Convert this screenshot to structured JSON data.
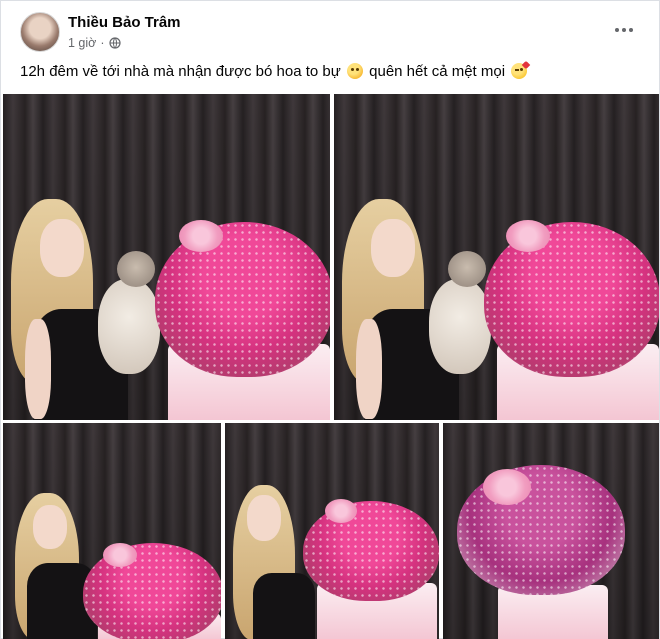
{
  "post": {
    "author": "Thiều Bảo Trâm",
    "time": "1 giờ",
    "privacy_icon": "globe-icon",
    "menu_icon": "more-dots-icon",
    "caption": {
      "part1": "12h đêm về tới nhà mà nhận được bó hoa to bự",
      "emoji1": "pleading-face-emoji",
      "part2": "quên hết cả mệt mọi",
      "emoji2": "kissing-face-emoji"
    }
  },
  "photos": [
    {
      "name": "photo-1",
      "subject": "girl-with-cat-and-bouquet"
    },
    {
      "name": "photo-2",
      "subject": "girl-with-cat-and-bouquet"
    },
    {
      "name": "photo-3",
      "subject": "girl-with-bouquet"
    },
    {
      "name": "photo-4",
      "subject": "girl-with-bouquet"
    },
    {
      "name": "photo-5",
      "subject": "bouquet"
    }
  ],
  "colors": {
    "text": "#050505",
    "meta": "#65676b",
    "bouquet_pink": "#e83e8c",
    "curtain": "#3b3436"
  }
}
